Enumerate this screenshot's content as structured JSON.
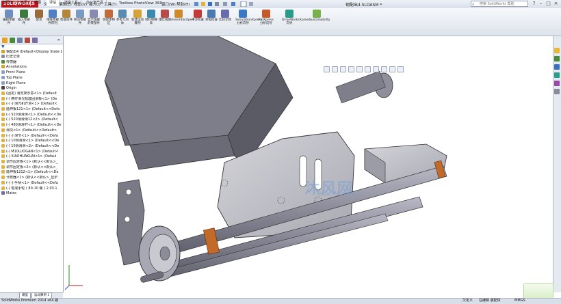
{
  "app": {
    "brand": "SOLIDWORKS",
    "document_title": "钢配出4.SLDASM *",
    "search_placeholder": "搜索 SolidWorks 帮助",
    "menus": [
      "文件(F)",
      "编辑(E)",
      "视图(V)",
      "插入(I)",
      "工具(T)",
      "Toolbox",
      "PhotoView 360",
      "窗口(W)",
      "帮助(H)"
    ]
  },
  "command_manager": {
    "tools": [
      {
        "label": "编辑零部件",
        "icon": "edit-component-icon"
      },
      {
        "label": "插入零部件",
        "icon": "insert-component-icon"
      },
      {
        "label": "配合",
        "icon": "mate-icon"
      },
      {
        "label": "线性零部件阵列",
        "icon": "pattern-icon"
      },
      {
        "label": "智能扣件",
        "icon": "smart-fastener-icon"
      },
      {
        "label": "移动零部件",
        "icon": "move-component-icon"
      },
      {
        "label": "显示隐藏的零部件",
        "icon": "show-hidden-icon"
      },
      {
        "label": "装配体特征",
        "icon": "assembly-feature-icon"
      },
      {
        "label": "参考几何体",
        "icon": "reference-geometry-icon"
      },
      {
        "label": "新建运动算例",
        "icon": "motion-study-icon"
      },
      {
        "label": "材料明细表",
        "icon": "bom-icon"
      },
      {
        "label": "爆炸视图",
        "icon": "explode-icon"
      },
      {
        "label": "AssemblyXpert",
        "icon": "assemblyxpert-icon"
      },
      {
        "label": "干涉检查",
        "icon": "interference-icon"
      },
      {
        "label": "对照检查",
        "icon": "clearance-icon"
      },
      {
        "label": "比较文档",
        "icon": "compare-icon"
      },
      {
        "label": "SimulationXpress 分析向导",
        "icon": "simulationxpress-icon"
      },
      {
        "label": "FloXpress 分析向导",
        "icon": "floxpress-icon"
      },
      {
        "label": "DriveWorksXpress 向导",
        "icon": "driveworks-icon"
      },
      {
        "label": "Sustainability",
        "icon": "sustainability-icon"
      }
    ],
    "tabs": [
      "装配体",
      "布局",
      "草图",
      "评估",
      "渲染工具",
      "办公室产品"
    ],
    "active_tab": "评估"
  },
  "feature_tree": {
    "root": "钢配出4 (Default<Display State-1",
    "items": [
      "历史记录",
      "传感器",
      "Annotations",
      "Front Plane",
      "Top Plane",
      "Right Plane",
      "Origin",
      "(固定) 滑支架示意<1> (Default",
      "(-) 两疗滑光机座固滑板<1> (De",
      "(-) 小滑光机齐滑<1> (Default<",
      "延伸板121<1> (Default<<Defa",
      "(-) 520滑滑滑<1> (Default<<De",
      "(-) 520滑滑滑12<2> (Default<",
      "(-) 480滑滑杆<1> (Default<<De",
      "滑块<1> (Default<<Default>",
      "(-) 小滑节<1> (Default<<Defa",
      "(-) 10滑滑滑<1> (Default<<De",
      "(-) 10滑滑滑<2> (Default<<De",
      "(-) M10LUOGAN<1> (Default<",
      "(-) XIAOHUAKUAI<1> (Defaul",
      "调节固定板<1> (默认<<默认>_",
      "调节固定板<2> (默认<<默认>_",
      "延伸板1212<1> (Default<<De",
      "计数器<1> (默认<<默认>_显示",
      "(-) 小手柄<1> (Default<<Defa",
      "(-) 笔滚手轮 ( 80-10 螺 ) 2.03.1",
      "Mates"
    ]
  },
  "left_panel_bottom": {
    "tab1": "模型",
    "tab2": "运动算例 1"
  },
  "statusbar": {
    "left": "SolidWorks Premium 2014 x64 版",
    "mid1": "欠定义",
    "mid2": "在编辑 装配体",
    "right": "MMGS"
  },
  "watermark": {
    "text": "沐风网",
    "url": "www.mfcad.com"
  },
  "colors": {
    "brand_red": "#c0141b",
    "model_gray": "#8d8d9a",
    "accent_copper": "#c26a2a"
  }
}
